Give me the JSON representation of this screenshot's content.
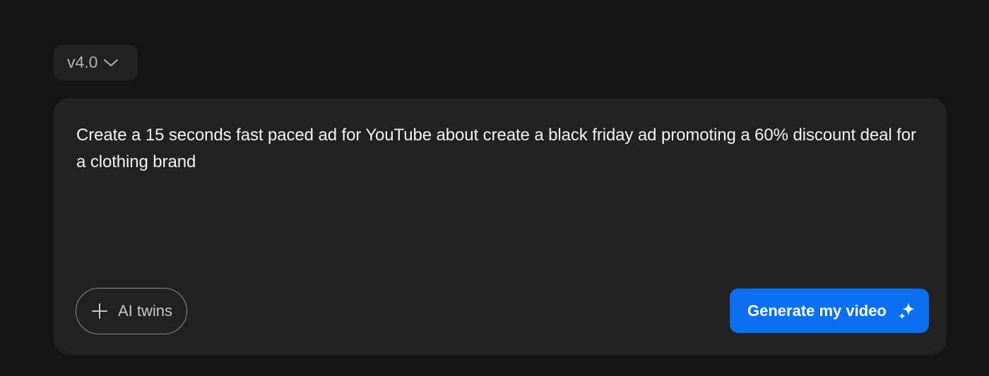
{
  "version_selector": {
    "label": "v4.0",
    "icon": "chevron-down-icon"
  },
  "prompt": {
    "text": "Create a 15 seconds fast paced ad for YouTube about create a black friday ad promoting a 60% discount deal for a clothing brand"
  },
  "ai_twins_button": {
    "label": "AI twins",
    "icon": "plus-icon"
  },
  "generate_button": {
    "label": "Generate my video",
    "icon": "sparkle-icon",
    "color": "#0a6ff0"
  },
  "colors": {
    "background": "#141414",
    "card": "#212121",
    "text": "#f2f2f2"
  }
}
